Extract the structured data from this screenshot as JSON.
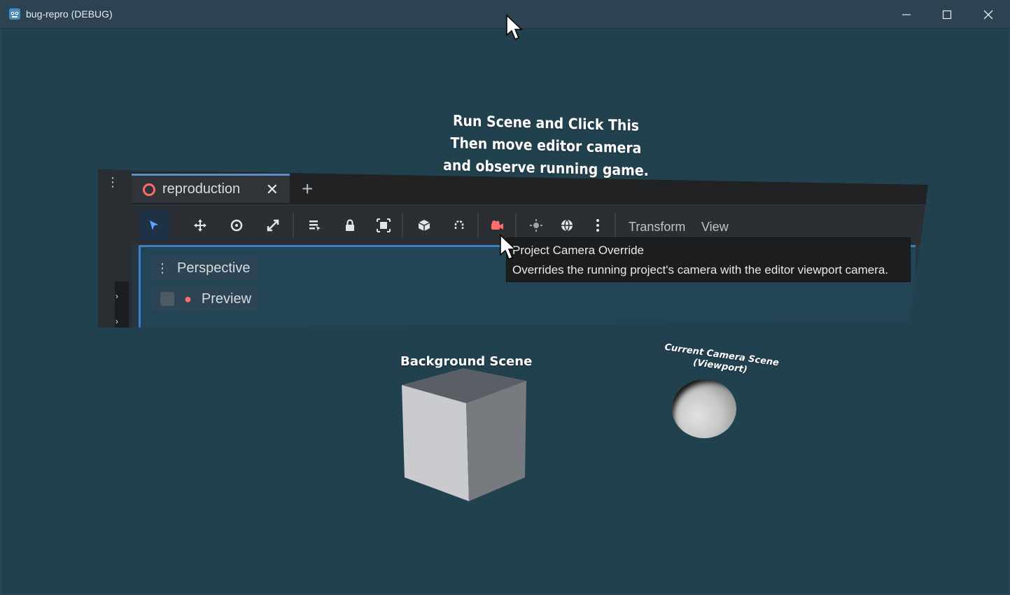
{
  "window": {
    "title": "bug-repro (DEBUG)",
    "app_icon": "godot-icon",
    "controls": {
      "minimize": "minimize-icon",
      "maximize": "maximize-icon",
      "close": "close-icon"
    }
  },
  "scene": {
    "instructions": [
      "Run Scene and Click This",
      "Then move editor camera",
      "and observe running game."
    ],
    "editor_screenshot": {
      "tab": {
        "label": "reproduction",
        "close": "✕"
      },
      "add_tab": "+",
      "toolbar_menus": {
        "transform": "Transform",
        "view": "View"
      },
      "perspective_label": "Perspective",
      "preview_label": "Preview"
    },
    "tooltip": {
      "title": "Project Camera Override",
      "description": "Overrides the running project's camera with the editor viewport camera."
    },
    "background_scene_label": "Background Scene",
    "camera_scene_label": [
      "Current Camera Scene",
      "(Viewport)"
    ]
  },
  "colors": {
    "viewport_bg": "#22414f",
    "accent_blue": "#3d7ec4",
    "override_red": "#ff6e6e"
  }
}
